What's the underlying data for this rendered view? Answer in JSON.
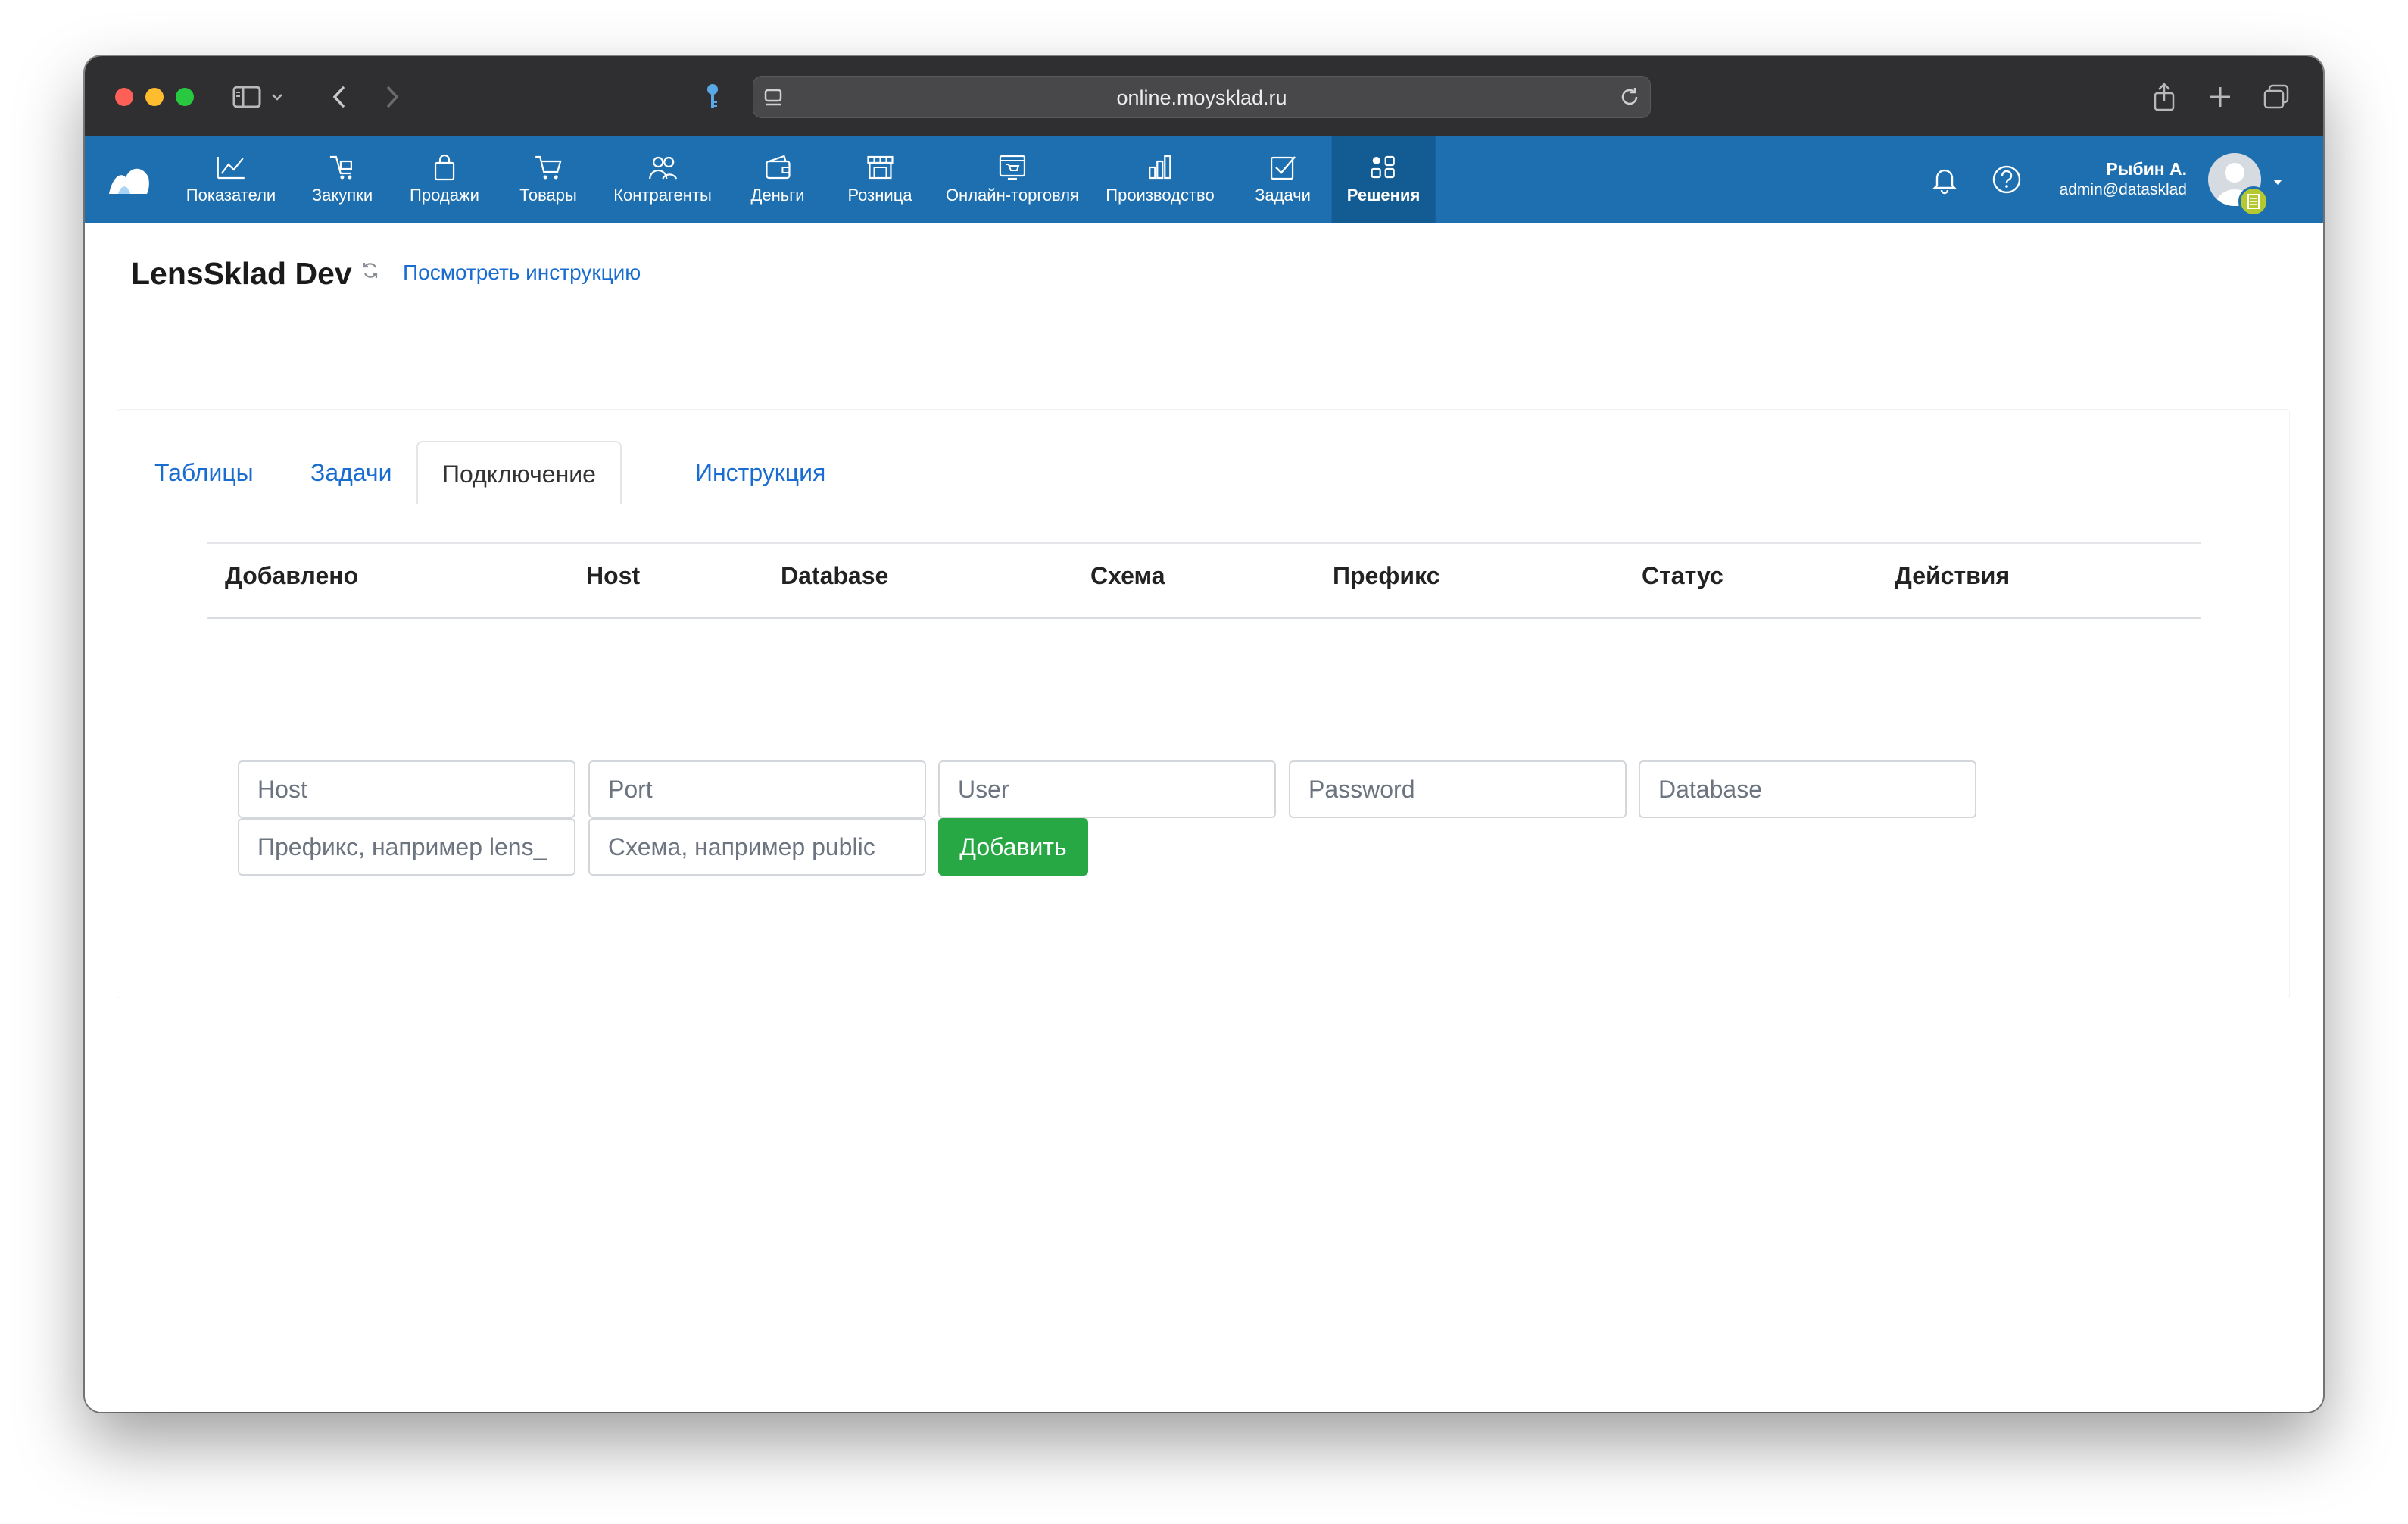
{
  "browser": {
    "url": "online.moysklad.ru"
  },
  "navbar": {
    "items": [
      {
        "label": "Показатели",
        "icon": "chart-line-icon"
      },
      {
        "label": "Закупки",
        "icon": "purchases-icon"
      },
      {
        "label": "Продажи",
        "icon": "shopping-bag-icon"
      },
      {
        "label": "Товары",
        "icon": "cart-icon"
      },
      {
        "label": "Контрагенты",
        "icon": "people-icon"
      },
      {
        "label": "Деньги",
        "icon": "wallet-icon"
      },
      {
        "label": "Розница",
        "icon": "store-icon"
      },
      {
        "label": "Онлайн-торговля",
        "icon": "online-store-icon"
      },
      {
        "label": "Производство",
        "icon": "production-icon"
      },
      {
        "label": "Задачи",
        "icon": "task-check-icon"
      },
      {
        "label": "Решения",
        "icon": "apps-grid-icon",
        "active": true
      }
    ],
    "user": {
      "name": "Рыбин А.",
      "email": "admin@datasklad"
    },
    "colors": {
      "navbar": "#1d6fb0",
      "active_item": "#135c93",
      "link": "#1a6dd0",
      "add_button": "#28a745"
    }
  },
  "page": {
    "title": "LensSklad Dev",
    "instruction_link": "Посмотреть инструкцию"
  },
  "tabs": [
    {
      "label": "Таблицы",
      "active": false
    },
    {
      "label": "Задачи",
      "active": false
    },
    {
      "label": "Подключение",
      "active": true
    },
    {
      "label": "Инструкция",
      "active": false
    }
  ],
  "table": {
    "columns": [
      "Добавлено",
      "Host",
      "Database",
      "Схема",
      "Префикс",
      "Статус",
      "Действия"
    ],
    "rows": []
  },
  "form": {
    "host_placeholder": "Host",
    "port_placeholder": "Port",
    "user_placeholder": "User",
    "password_placeholder": "Password",
    "database_placeholder": "Database",
    "prefix_placeholder": "Префикс, например lens_",
    "schema_placeholder": "Схема, например public",
    "add_label": "Добавить"
  }
}
